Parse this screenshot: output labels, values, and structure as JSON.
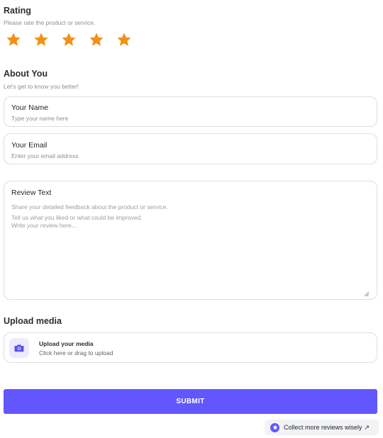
{
  "rating": {
    "title": "Rating",
    "subtitle": "Please rate the product or service.",
    "value": 5,
    "max": 5,
    "star_color": "#f39014",
    "icon": "star-icon"
  },
  "about": {
    "title": "About You",
    "subtitle": "Let's get to know you better!"
  },
  "name_field": {
    "label": "Your Name",
    "placeholder": "Type your name here"
  },
  "email_field": {
    "label": "Your Email",
    "placeholder": "Enter your email address"
  },
  "review_field": {
    "label": "Review Text",
    "lines": [
      "Share your detailed feedback about the product or service.",
      "Tell us what you liked or what could be improved.",
      "Write your review here..."
    ]
  },
  "upload": {
    "title": "Upload media",
    "box_title": "Upload your media",
    "box_subtitle": "Click here or drag to upload",
    "icon": "camera-icon"
  },
  "submit": {
    "label": "SUBMIT",
    "color": "#6257ff"
  },
  "footer": {
    "collect_label": "Collect more reviews wisely",
    "arrow": "↗"
  }
}
